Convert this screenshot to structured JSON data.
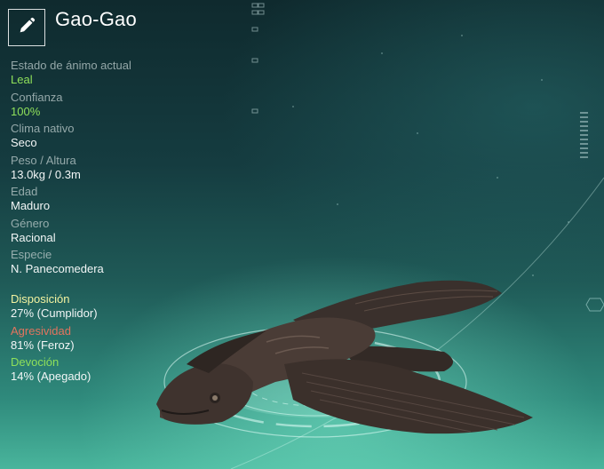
{
  "creature": {
    "name": "Gao-Gao"
  },
  "stats": [
    {
      "label": "Estado de ánimo actual",
      "value": "Leal",
      "highlight": true
    },
    {
      "label": "Confianza",
      "value": "100%",
      "highlight": true
    },
    {
      "label": "Clima nativo",
      "value": "Seco",
      "highlight": false
    },
    {
      "label": "Peso / Altura",
      "value": "13.0kg / 0.3m",
      "highlight": false
    },
    {
      "label": "Edad",
      "value": "Maduro",
      "highlight": false
    },
    {
      "label": "Género",
      "value": "Racional",
      "highlight": false
    },
    {
      "label": "Especie",
      "value": "N. Panecomedera",
      "highlight": false
    }
  ],
  "traits": [
    {
      "label": "Disposición",
      "value": "27% (Cumplidor)",
      "color": "#f3f3a0"
    },
    {
      "label": "Agresividad",
      "value": "81% (Feroz)",
      "color": "#e2745e"
    },
    {
      "label": "Devoción",
      "value": "14% (Apegado)",
      "color": "#8fe05a"
    }
  ],
  "icons": {
    "edit": "pencil-icon"
  }
}
